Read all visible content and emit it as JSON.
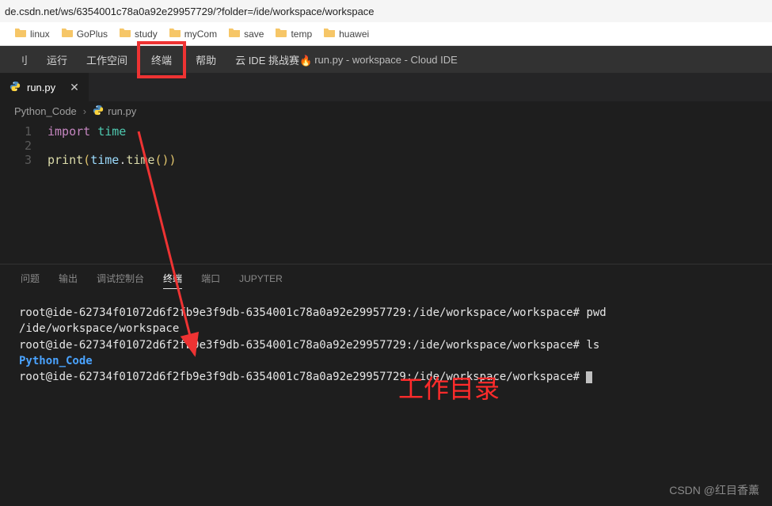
{
  "url": "de.csdn.net/ws/6354001c78a0a92e29957729/?folder=/ide/workspace/workspace",
  "bookmarks": [
    "linux",
    "GoPlus",
    "study",
    "myCom",
    "save",
    "temp",
    "huawei"
  ],
  "menubar": {
    "items": [
      "刂",
      "运行",
      "工作空间",
      "终端",
      "帮助",
      "云 IDE 挑战赛"
    ],
    "highlighted_index": 3,
    "flame": "🔥",
    "title": "run.py - workspace - Cloud IDE"
  },
  "tab": {
    "filename": "run.py",
    "close": "✕"
  },
  "breadcrumb": {
    "folder": "Python_Code",
    "file": "run.py"
  },
  "editor": {
    "lines": [
      {
        "n": "1",
        "tokens": [
          {
            "t": "import",
            "c": "kw"
          },
          {
            "t": " ",
            "c": ""
          },
          {
            "t": "time",
            "c": "id"
          }
        ]
      },
      {
        "n": "2",
        "tokens": []
      },
      {
        "n": "3",
        "tokens": [
          {
            "t": "print",
            "c": "fn"
          },
          {
            "t": "(",
            "c": "pn"
          },
          {
            "t": "time",
            "c": "id2"
          },
          {
            "t": ".",
            "c": ""
          },
          {
            "t": "time",
            "c": "fn"
          },
          {
            "t": "()",
            "c": "pn"
          },
          {
            "t": ")",
            "c": "pn"
          }
        ]
      }
    ]
  },
  "panel_tabs": {
    "items": [
      "问题",
      "输出",
      "调试控制台",
      "终端",
      "端口",
      "JUPYTER"
    ],
    "active_index": 3
  },
  "terminal": {
    "prompt_host": "root@ide-62734f01072d6f2fb9e3f9db-6354001c78a0a92e29957729",
    "prompt_path": "/ide/workspace/workspace",
    "lines": [
      {
        "type": "cmd",
        "cmd": "pwd"
      },
      {
        "type": "out",
        "text": "/ide/workspace/workspace"
      },
      {
        "type": "cmd",
        "cmd": "ls"
      },
      {
        "type": "dir",
        "text": "Python_Code"
      },
      {
        "type": "cmd",
        "cmd": ""
      }
    ]
  },
  "annotation": "工作目录",
  "watermark": "CSDN @红目香薰"
}
